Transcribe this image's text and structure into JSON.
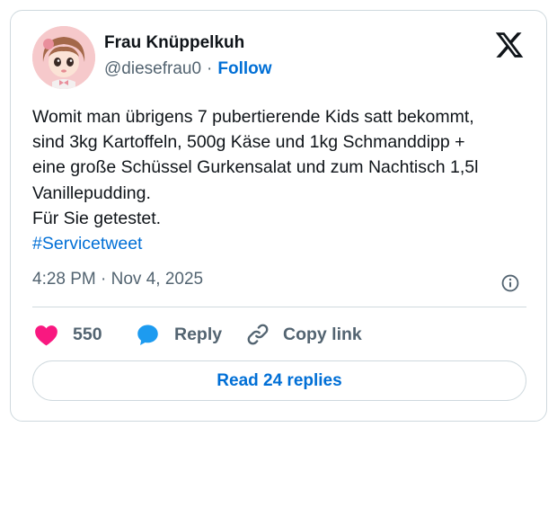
{
  "author": {
    "display_name": "Frau Knüppelkuh",
    "handle": "@diesefrau0",
    "separator": "·",
    "follow_label": "Follow"
  },
  "tweet": {
    "lines": [
      "Womit man übrigens 7 pubertierende Kids satt bekommt,",
      "sind 3kg Kartoffeln, 500g Käse und 1kg Schmanddipp +",
      "eine große Schüssel Gurkensalat und zum Nachtisch 1,5l",
      "Vanillepudding.",
      "Für Sie getestet."
    ],
    "hashtag": "#Servicetweet",
    "timestamp": "4:28 PM · Nov 4, 2025"
  },
  "actions": {
    "like_count": "550",
    "reply_label": "Reply",
    "copy_link_label": "Copy link",
    "read_replies_label": "Read 24 replies"
  },
  "icons": {
    "brand": "x-logo-icon",
    "info": "info-icon",
    "like": "heart-icon",
    "reply": "speech-bubble-icon",
    "copy": "link-icon"
  },
  "colors": {
    "link": "#006fd6",
    "like": "#f91880",
    "reply": "#1d9bf0",
    "secondary_text": "#536471",
    "border": "#cfd9de"
  }
}
